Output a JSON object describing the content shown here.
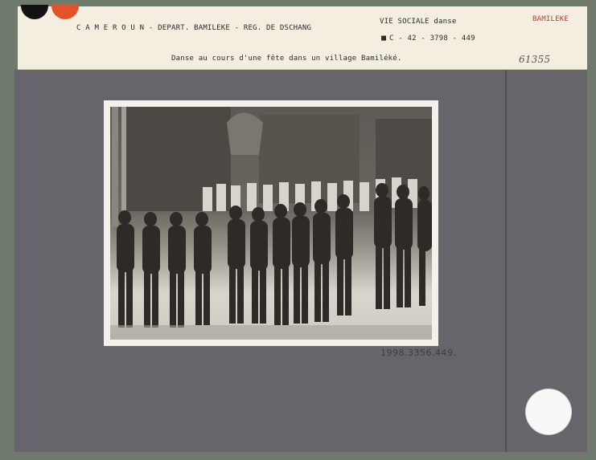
{
  "label": {
    "location_line": "C A M E R O U N  -  DEPART. BAMILEKE  -  REG. DE DSCHANG",
    "category": "VIE SOCIALE  danse",
    "reference_code": "C - 42 - 3798 - 449",
    "region_stamp": "BAMILEKE",
    "caption": "Danse au cours d'une fête dans un village Bamiléké.",
    "handwritten_number": "61355"
  },
  "mount": {
    "inventory_number": "1998.3356.449."
  },
  "colors": {
    "label_paper": "#f3eee0",
    "board": "#66656b",
    "stamp_red": "#c23a2e",
    "sticker_dot_black": "#121212",
    "sticker_dot_orange": "#e4522a"
  }
}
